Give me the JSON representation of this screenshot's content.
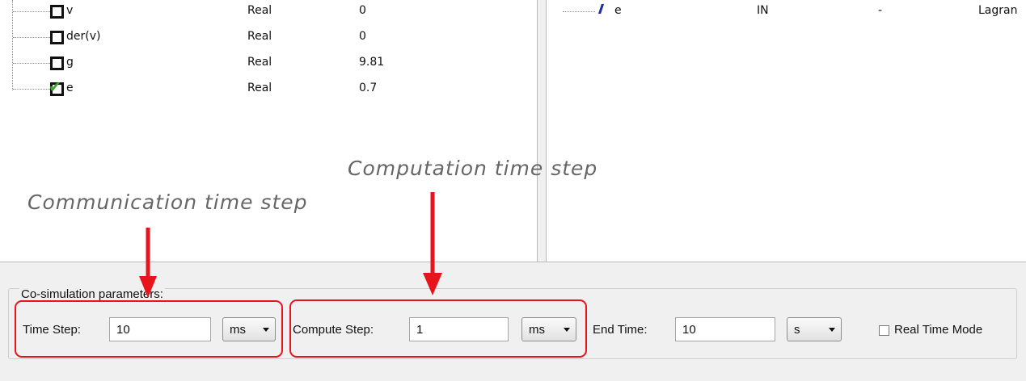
{
  "variables": [
    {
      "name": "v",
      "type": "Real",
      "value": "0",
      "state": "unchecked"
    },
    {
      "name": "der(v)",
      "type": "Real",
      "value": "0",
      "state": "unchecked"
    },
    {
      "name": "g",
      "type": "Real",
      "value": "9.81",
      "state": "unchecked"
    },
    {
      "name": "e",
      "type": "Real",
      "value": "0.7",
      "state": "checked"
    }
  ],
  "ports": [
    {
      "name": "e",
      "direction": "IN",
      "dash": "-",
      "kind": "Lagran"
    }
  ],
  "annotations": {
    "computation": "Computation time step",
    "communication": "Communication time step"
  },
  "cosim": {
    "title": "Co-simulation parameters:",
    "time_step_label": "Time Step:",
    "time_step_value": "10",
    "time_step_unit": "ms",
    "compute_step_label": "Compute Step:",
    "compute_step_value": "1",
    "compute_step_unit": "ms",
    "end_time_label": "End Time:",
    "end_time_value": "10",
    "end_time_unit": "s",
    "real_time_label": "Real Time Mode"
  },
  "colors": {
    "highlight": "#e8141c",
    "check": "#3aa52a",
    "annotation_text": "#666666",
    "panel_bg": "#f0f0f0"
  }
}
